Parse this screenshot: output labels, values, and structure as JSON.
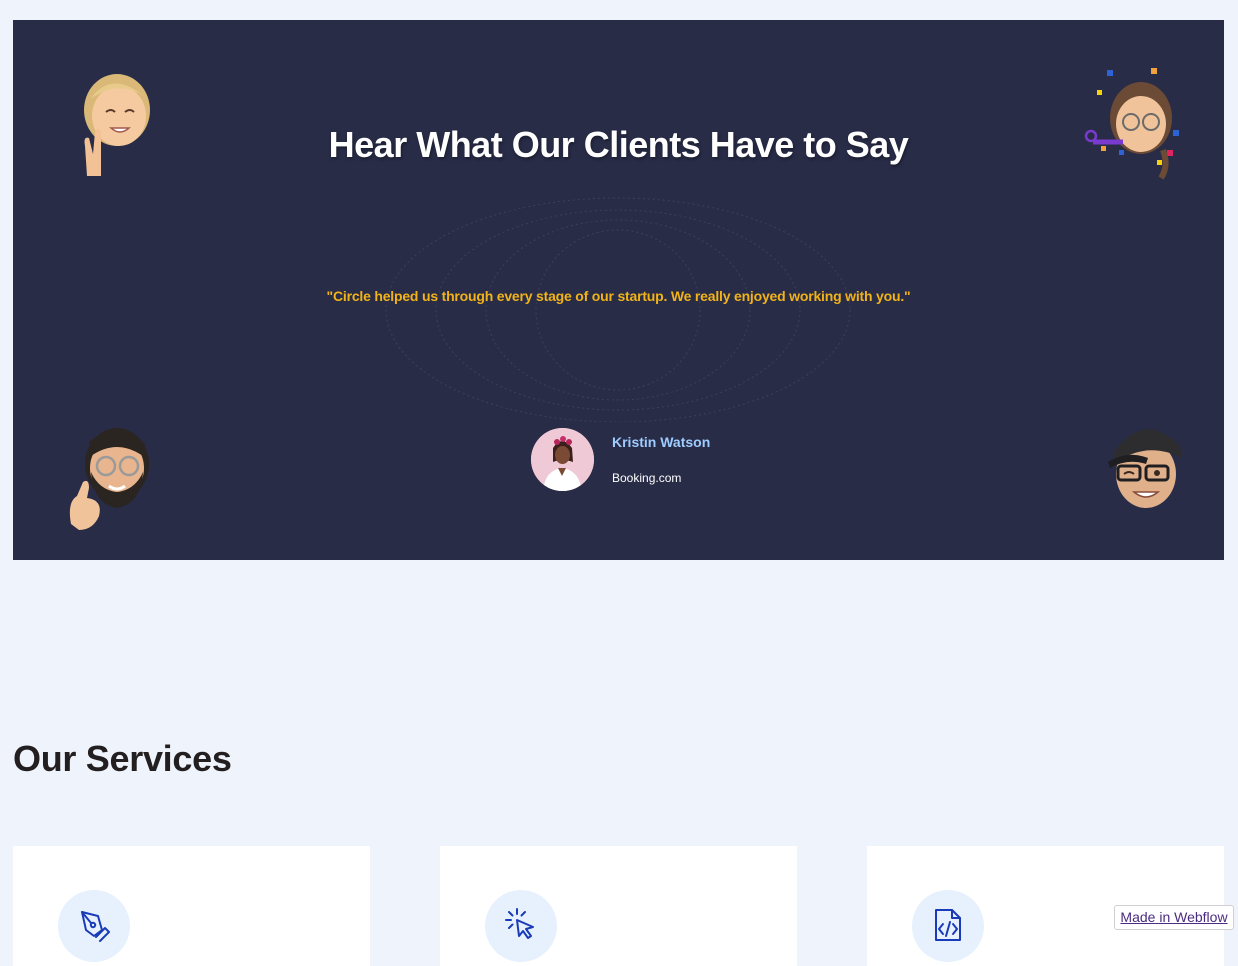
{
  "testimonials": {
    "title": "Hear What Our Clients Have to Say",
    "quote": "\"Circle helped us through every stage of our startup. We really enjoyed working with you.\"",
    "author_name": "Kristin Watson",
    "author_company": "Booking.com"
  },
  "services": {
    "title": "Our Services",
    "cards": [
      {
        "icon": "pen-tool-icon"
      },
      {
        "icon": "cursor-click-icon"
      },
      {
        "icon": "code-file-icon"
      }
    ]
  },
  "badge": {
    "label": "Made in Webflow"
  },
  "colors": {
    "page_bg": "#eff3fb",
    "section_bg": "#282c47",
    "quote": "#f2b318",
    "author_name": "#9fccff",
    "icon": "#1a3bb8",
    "icon_bg": "#e6f1fd"
  }
}
